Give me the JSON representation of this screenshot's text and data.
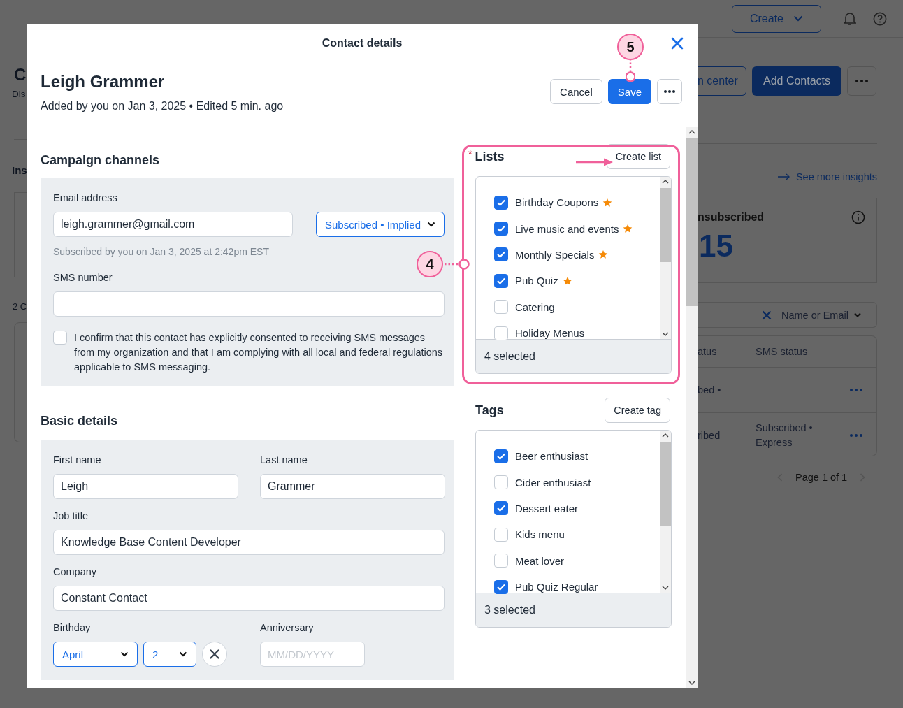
{
  "background": {
    "header": {
      "create_button": "Create"
    },
    "left_fragments": {
      "page_title": "C",
      "subtitle": "Dis",
      "section_title": "Ins",
      "contact_count": "2 C"
    },
    "action_buttons": [
      {
        "label": "n center",
        "kind": "outline"
      },
      {
        "label": "Add Contacts",
        "kind": "primary"
      }
    ],
    "insights_link": "See more insights",
    "stat_card": {
      "label": "nsubscribed",
      "value": "15"
    },
    "search": {
      "filter": "Name or Email"
    },
    "table": {
      "columns": [
        "atus",
        "SMS status"
      ],
      "rows": [
        {
          "column_1": "bed •"
        },
        {
          "column_1": "ribed",
          "sms_status": "Subscribed • Express"
        }
      ]
    },
    "pagination": "Page 1 of 1"
  },
  "modal": {
    "title": "Contact details",
    "contact": {
      "name": "Leigh Grammer",
      "meta": "Added by you on Jan 3, 2025 • Edited 5 min. ago"
    },
    "buttons": [
      {
        "label": "Cancel",
        "kind": "secondary"
      },
      {
        "label": "Save",
        "kind": "primary"
      }
    ],
    "campaign_channels": {
      "heading": "Campaign channels",
      "email_label": "Email address",
      "email": "leigh.grammer@gmail.com",
      "email_status": "Subscribed • Implied",
      "email_note": "Subscribed by you on Jan 3, 2025 at 2:42pm EST",
      "sms_label": "SMS number",
      "consent": {
        "checked": false,
        "text": "I confirm that this contact has explicitly consented to receiving SMS messages from my organization and that I am complying with all local and federal regulations applicable to SMS messaging."
      }
    },
    "basic_details": {
      "heading": "Basic details",
      "first_name": {
        "label": "First name",
        "value": "Leigh"
      },
      "last_name": {
        "label": "Last name",
        "value": "Grammer"
      },
      "job_title": {
        "label": "Job title",
        "value": "Knowledge Base Content Developer"
      },
      "company": {
        "label": "Company",
        "value": "Constant Contact"
      },
      "birthday": {
        "label": "Birthday",
        "month": "April",
        "day": "2"
      },
      "anniversary": {
        "label": "Anniversary",
        "placeholder": "MM/DD/YYYY"
      }
    },
    "lists": {
      "required_mark": "*",
      "heading": "Lists",
      "create_button": "Create list",
      "items": [
        {
          "label": "Birthday Coupons",
          "checked": true,
          "starred": true
        },
        {
          "label": "Live music and events",
          "checked": true,
          "starred": true
        },
        {
          "label": "Monthly Specials",
          "checked": true,
          "starred": true
        },
        {
          "label": "Pub Quiz",
          "checked": true,
          "starred": true
        },
        {
          "label": "Catering",
          "checked": false,
          "starred": false
        },
        {
          "label": "Holiday Menus",
          "checked": false,
          "starred": false
        }
      ],
      "footer": "4 selected"
    },
    "tags": {
      "heading": "Tags",
      "create_button": "Create tag",
      "items": [
        {
          "label": "Beer enthusiast",
          "checked": true
        },
        {
          "label": "Cider enthusiast",
          "checked": false
        },
        {
          "label": "Dessert eater",
          "checked": true
        },
        {
          "label": "Kids menu",
          "checked": false
        },
        {
          "label": "Meat lover",
          "checked": false
        },
        {
          "label": "Pub Quiz Regular",
          "checked": true
        }
      ],
      "footer": "3 selected"
    }
  },
  "annotations": [
    {
      "label": "5"
    },
    {
      "label": "4"
    }
  ]
}
